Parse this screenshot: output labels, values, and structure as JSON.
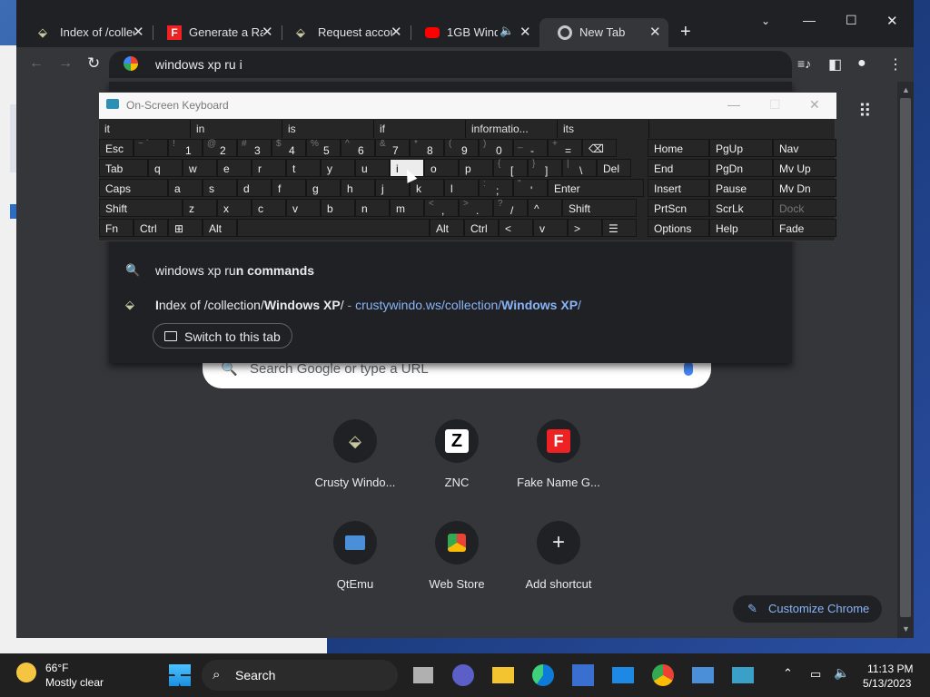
{
  "tabs": [
    {
      "title": "Index of /collec",
      "icon": "crusty-icon"
    },
    {
      "title": "Generate a Ran",
      "icon": "fakename-icon"
    },
    {
      "title": "Request accou",
      "icon": "crusty-icon"
    },
    {
      "title": "1GB Windo",
      "icon": "youtube-icon"
    },
    {
      "title": "New Tab",
      "icon": "chrome-icon"
    }
  ],
  "omnibox": {
    "text": "windows xp ru i"
  },
  "suggestions": [
    {
      "plain": "windows xp ru",
      "bold": "n commands"
    },
    {
      "prefix": "I",
      "bold1": "ndex of /collection/",
      "hl1": "Windows XP",
      "tail": "/",
      "sep": " - ",
      "url1": "crustywindo.ws/collection/",
      "url2": "Windows XP",
      "url3": "/"
    }
  ],
  "switch_tab": "Switch to this tab",
  "search_placeholder": "Search Google or type a URL",
  "shortcuts": [
    {
      "label": "Crusty Windo..."
    },
    {
      "label": "ZNC"
    },
    {
      "label": "Fake Name G..."
    },
    {
      "label": "QtEmu"
    },
    {
      "label": "Web Store"
    },
    {
      "label": "Add shortcut"
    }
  ],
  "customize": "Customize Chrome",
  "osk": {
    "title": "On-Screen Keyboard",
    "predictions": [
      "it",
      "in",
      "is",
      "if",
      "informatio...",
      "its"
    ],
    "rows": [
      [
        {
          "m": "Esc"
        },
        {
          "s": "~ `"
        },
        {
          "s": "!",
          "m": "1"
        },
        {
          "s": "@",
          "m": "2"
        },
        {
          "s": "#",
          "m": "3"
        },
        {
          "s": "$",
          "m": "4"
        },
        {
          "s": "%",
          "m": "5"
        },
        {
          "s": "^",
          "m": "6"
        },
        {
          "s": "&",
          "m": "7"
        },
        {
          "s": "*",
          "m": "8"
        },
        {
          "s": "(",
          "m": "9"
        },
        {
          "s": ")",
          "m": "0"
        },
        {
          "s": "_",
          "m": "-"
        },
        {
          "s": "+",
          "m": "="
        },
        {
          "m": "⌫"
        }
      ],
      [
        {
          "m": "Tab"
        },
        {
          "m": "q"
        },
        {
          "m": "w"
        },
        {
          "m": "e"
        },
        {
          "m": "r"
        },
        {
          "m": "t"
        },
        {
          "m": "y"
        },
        {
          "m": "u"
        },
        {
          "m": "i"
        },
        {
          "m": "o"
        },
        {
          "m": "p"
        },
        {
          "s": "{",
          "m": "["
        },
        {
          "s": "}",
          "m": "]"
        },
        {
          "s": "|",
          "m": "\\"
        },
        {
          "m": "Del"
        }
      ],
      [
        {
          "m": "Caps"
        },
        {
          "m": "a"
        },
        {
          "m": "s"
        },
        {
          "m": "d"
        },
        {
          "m": "f"
        },
        {
          "m": "g"
        },
        {
          "m": "h"
        },
        {
          "m": "j"
        },
        {
          "m": "k"
        },
        {
          "m": "l"
        },
        {
          "s": ":",
          "m": ";"
        },
        {
          "s": "\"",
          "m": "'"
        },
        {
          "m": "Enter"
        }
      ],
      [
        {
          "m": "Shift"
        },
        {
          "m": "z"
        },
        {
          "m": "x"
        },
        {
          "m": "c"
        },
        {
          "m": "v"
        },
        {
          "m": "b"
        },
        {
          "m": "n"
        },
        {
          "m": "m"
        },
        {
          "s": "<",
          "m": ","
        },
        {
          "s": ">",
          "m": "."
        },
        {
          "s": "?",
          "m": "/"
        },
        {
          "m": "^"
        },
        {
          "m": "Shift"
        }
      ],
      [
        {
          "m": "Fn"
        },
        {
          "m": "Ctrl"
        },
        {
          "m": "⊞"
        },
        {
          "m": "Alt"
        },
        {
          "m": ""
        },
        {
          "m": "Alt"
        },
        {
          "m": "Ctrl"
        },
        {
          "m": "<"
        },
        {
          "m": "v"
        },
        {
          "m": ">"
        },
        {
          "m": "☰"
        }
      ]
    ],
    "nav": [
      [
        "Home",
        "PgUp",
        "Nav"
      ],
      [
        "End",
        "PgDn",
        "Mv Up"
      ],
      [
        "Insert",
        "Pause",
        "Mv Dn"
      ],
      [
        "PrtScn",
        "ScrLk",
        "Dock"
      ],
      [
        "Options",
        "Help",
        "Fade"
      ]
    ]
  },
  "taskbar": {
    "weather_temp": "66°F",
    "weather_desc": "Mostly clear",
    "search": "Search",
    "time": "11:13 PM",
    "date": "5/13/2023"
  }
}
